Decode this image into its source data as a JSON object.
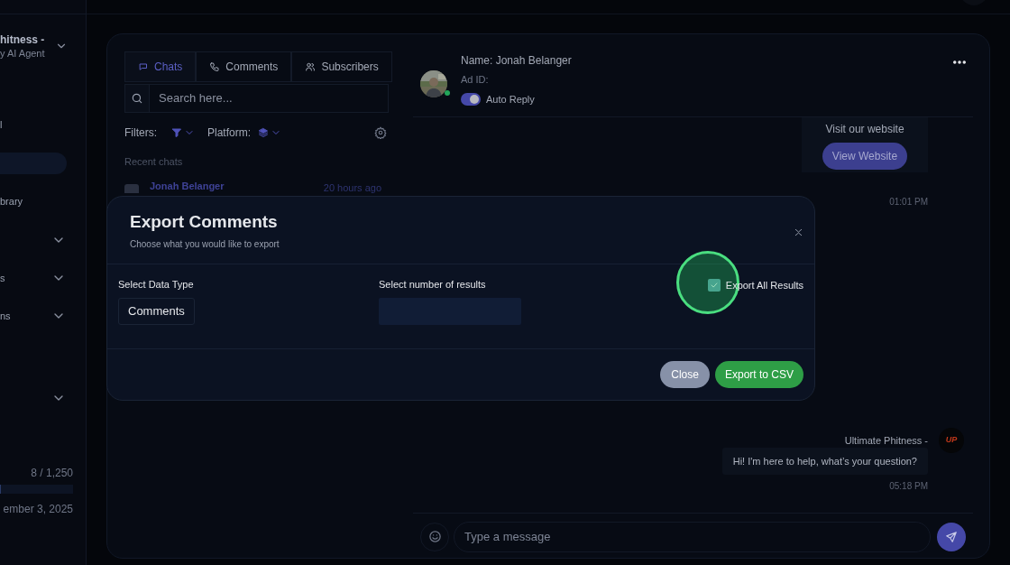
{
  "sidebar": {
    "account": {
      "name": "hitness -",
      "subtitle": "y AI Agent",
      "chevron": true
    },
    "items": [
      {
        "label": "l",
        "selected": false,
        "chevron": false
      },
      {
        "selected": true,
        "chevron": false
      },
      {
        "label": "brary",
        "selected": false,
        "chevron": false
      },
      {
        "selected": false,
        "chevron": true
      },
      {
        "label": "s",
        "selected": false,
        "chevron": true
      },
      {
        "label": "ns",
        "selected": false,
        "chevron": true
      },
      {
        "selected": false,
        "chevron": true
      }
    ],
    "usage": {
      "count": "8 / 1,250",
      "level": 0.01,
      "date": "ember 3, 2025"
    }
  },
  "chat_list": {
    "tabs": [
      {
        "label": "Chats",
        "selected": true
      },
      {
        "label": "Comments",
        "selected": false
      },
      {
        "label": "Subscribers",
        "selected": false
      }
    ],
    "search": {
      "placeholder": "Search here..."
    },
    "filters_label": "Filters:",
    "platform_label": "Platform:",
    "section_title": "Recent chats",
    "chats": [
      {
        "name": "Jonah Belanger",
        "time": "20 hours ago"
      }
    ]
  },
  "conversation": {
    "contact": {
      "name": "Name: Jonah Belanger",
      "ad_id": "Ad ID:",
      "online": true,
      "auto_reply": {
        "label": "Auto Reply",
        "on": true
      }
    },
    "messages": [
      {
        "kind": "card",
        "text": "Visit our website",
        "button": "View Website",
        "time": "01:01 PM"
      },
      {
        "kind": "bubble",
        "sender": "Ultimate Phitness -",
        "avatar_text": "UP",
        "text": "Hi! I'm here to help, what’s your question?",
        "time": "05:18 PM"
      }
    ],
    "composer": {
      "placeholder": "Type a message"
    }
  },
  "modal": {
    "title": "Export Comments",
    "subtitle": "Choose what you would like to export",
    "data_type": {
      "label": "Select Data Type",
      "value": "Comments"
    },
    "results": {
      "label": "Select number of results"
    },
    "export_all": {
      "label": "Export All Results",
      "checked": true,
      "highlighted": true
    },
    "buttons": [
      {
        "label": "Close",
        "kind": "secondary"
      },
      {
        "label": "Export to CSV",
        "kind": "primary"
      }
    ]
  }
}
